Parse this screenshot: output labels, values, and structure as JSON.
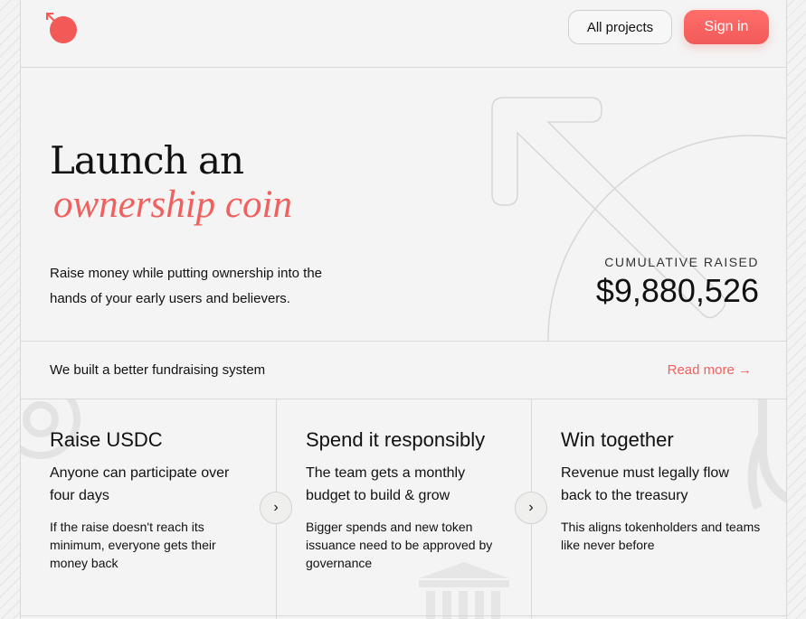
{
  "header": {
    "logo_icon": "coin-arrow-logo-icon",
    "all_projects_label": "All projects",
    "sign_in_label": "Sign in",
    "accent_color": "#f0605e"
  },
  "hero": {
    "title_line1": "Launch an",
    "title_line2": "ownership coin",
    "description": "Raise money while putting ownership into the hands of your early users and believers.",
    "cumulative_label": "CUMULATIVE RAISED",
    "cumulative_value": "$9,880,526"
  },
  "strip": {
    "text": "We built a better fundraising system",
    "read_more": "Read more →"
  },
  "features": [
    {
      "title": "Raise USDC",
      "subtitle": "Anyone can participate over four days",
      "detail": "If the raise doesn't reach its minimum, everyone gets their money back"
    },
    {
      "title": "Spend it responsibly",
      "subtitle": "The team gets a monthly budget to build & grow",
      "detail": "Bigger spends and new token issuance need to be approved by governance"
    },
    {
      "title": "Win together",
      "subtitle": "Revenue must legally flow back to the treasury",
      "detail": "This aligns tokenholders and teams like never before"
    }
  ],
  "next_arrow": "›"
}
